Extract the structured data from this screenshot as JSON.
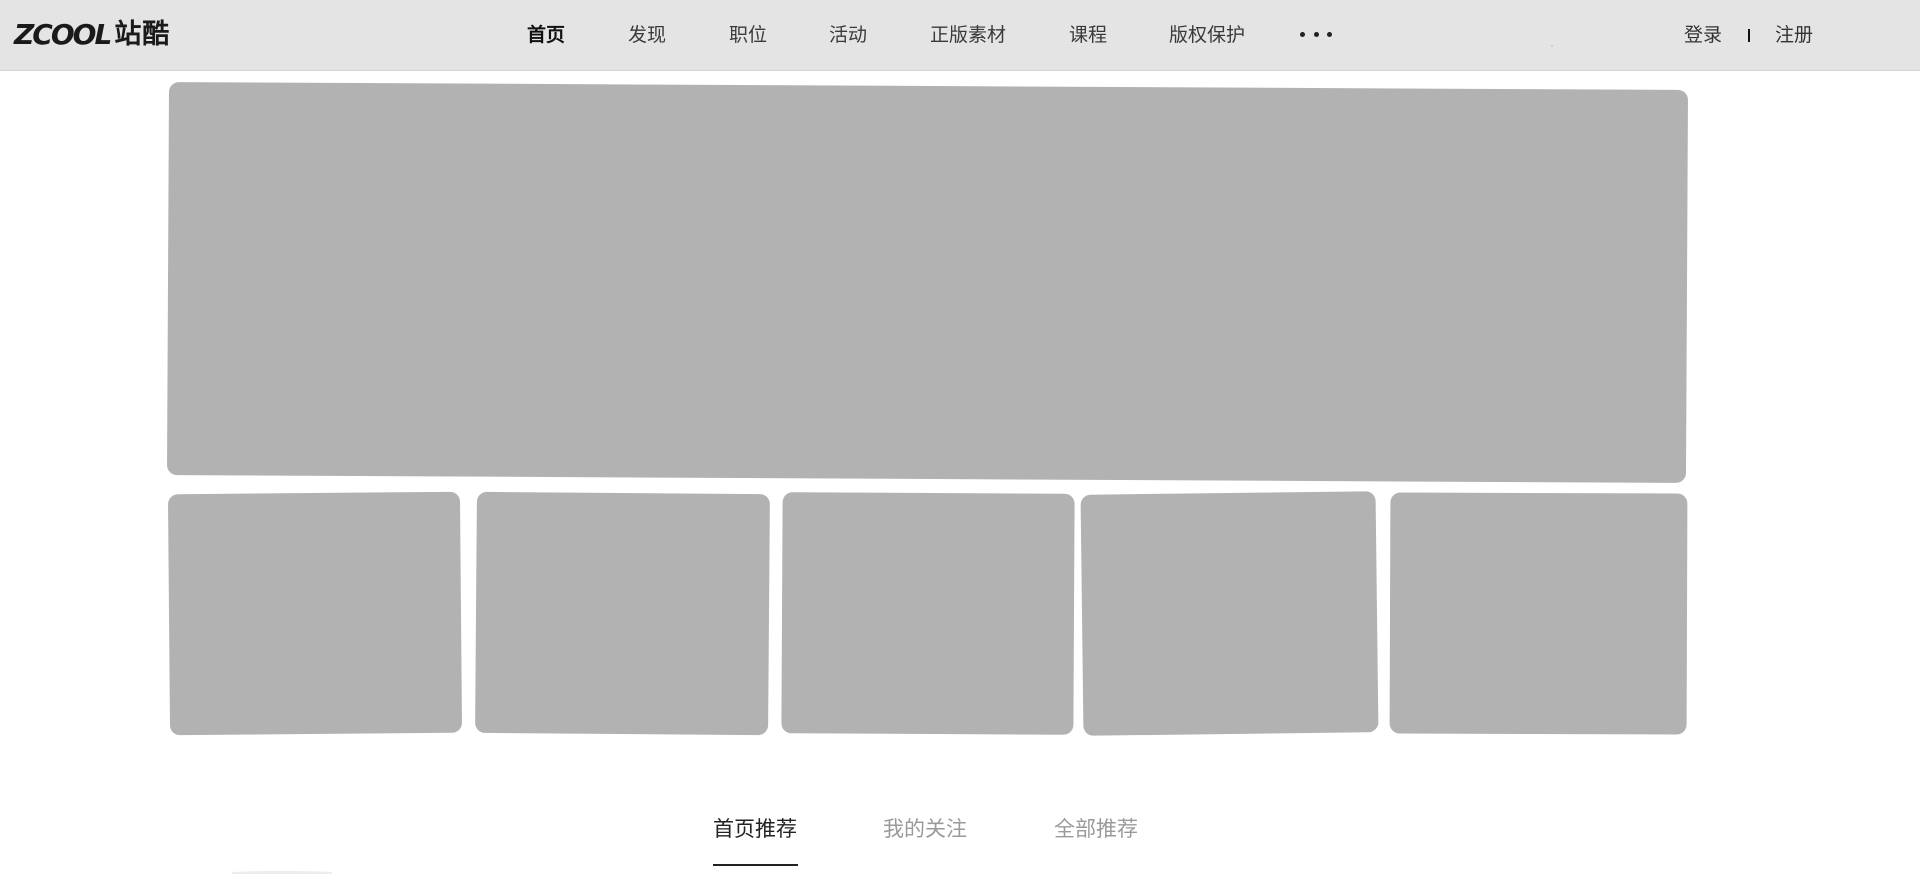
{
  "header": {
    "logo": {
      "latin": "ZCOOL",
      "chinese": "站酷"
    },
    "nav": [
      {
        "label": "首页",
        "active": true
      },
      {
        "label": "发现",
        "active": false
      },
      {
        "label": "职位",
        "active": false
      },
      {
        "label": "活动",
        "active": false
      },
      {
        "label": "正版素材",
        "active": false
      },
      {
        "label": "课程",
        "active": false
      },
      {
        "label": "版权保护",
        "active": false
      }
    ],
    "more_icon": "more-dots-icon",
    "auth": {
      "login": "登录",
      "register": "注册"
    }
  },
  "feed_tabs": [
    {
      "label": "首页推荐",
      "active": true
    },
    {
      "label": "我的关注",
      "active": false
    },
    {
      "label": "全部推荐",
      "active": false
    }
  ],
  "colors": {
    "header_bg": "#e4e4e4",
    "placeholder": "#b2b2b2",
    "active_text": "#111111",
    "inactive_tab": "#9a9a9a"
  }
}
